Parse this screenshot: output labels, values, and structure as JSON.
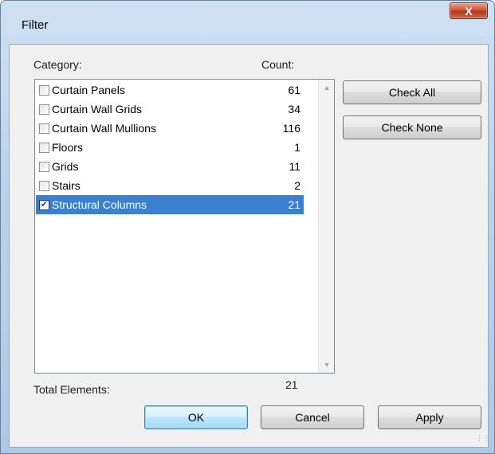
{
  "window": {
    "title": "Filter",
    "close_label": "X"
  },
  "labels": {
    "category": "Category:",
    "count": "Count:",
    "total": "Total Elements:",
    "total_value": "21"
  },
  "list": {
    "items": [
      {
        "name": "Curtain Panels",
        "count": "61",
        "checked": false
      },
      {
        "name": "Curtain Wall Grids",
        "count": "34",
        "checked": false
      },
      {
        "name": "Curtain Wall Mullions",
        "count": "116",
        "checked": false
      },
      {
        "name": "Floors",
        "count": "1",
        "checked": false
      },
      {
        "name": "Grids",
        "count": "11",
        "checked": false
      },
      {
        "name": "Stairs",
        "count": "2",
        "checked": false
      },
      {
        "name": "Structural Columns",
        "count": "21",
        "checked": true
      }
    ]
  },
  "buttons": {
    "check_all": "Check All",
    "check_none": "Check None",
    "ok": "OK",
    "cancel": "Cancel",
    "apply": "Apply"
  },
  "colors": {
    "selection": "#3b7fd0",
    "titlebar": "#bcd3ec"
  }
}
